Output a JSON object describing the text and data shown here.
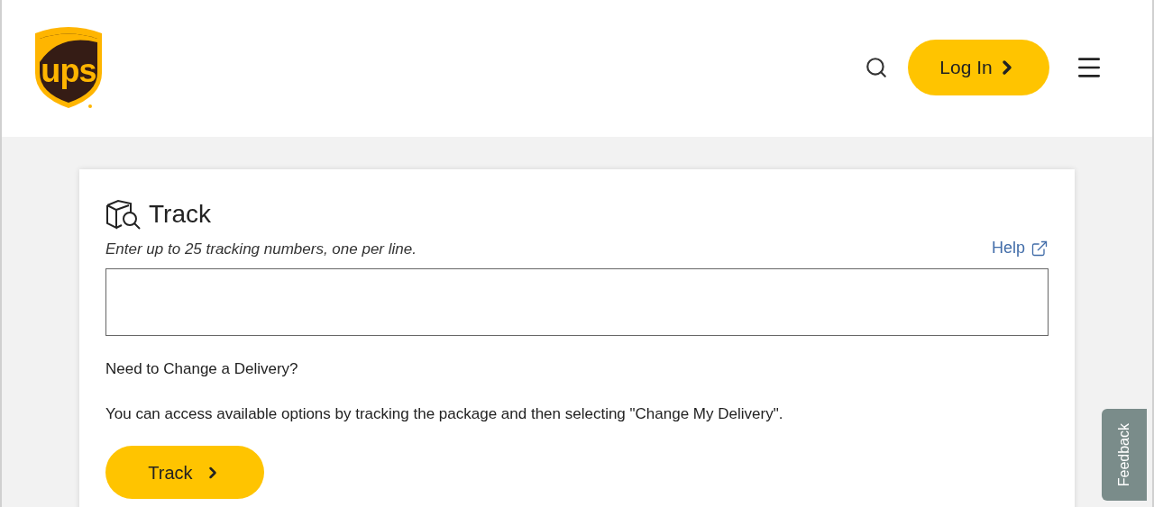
{
  "header": {
    "logo_text": "ups",
    "login_button": "Log In"
  },
  "track": {
    "title": "Track",
    "instruction": "Enter up to 25 tracking numbers, one per line.",
    "help_link": "Help",
    "question": "Need to Change a Delivery?",
    "info": "You can access available options by tracking the package and then selecting \"Change My Delivery\".",
    "button": "Track"
  },
  "feedback_tab": "Feedback"
}
